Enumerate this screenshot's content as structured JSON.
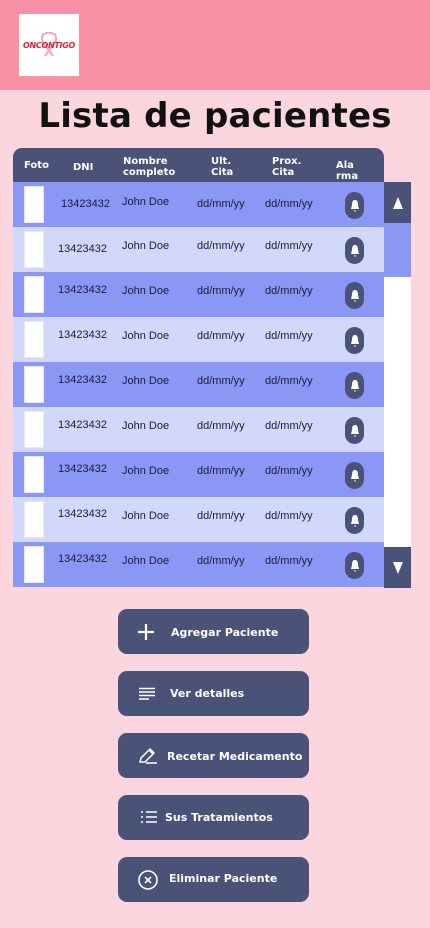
{
  "header": {
    "logo_text": "ONCONTIGO",
    "colors": {
      "bar": "#f891a5",
      "background": "#fcd6de"
    }
  },
  "page_title": "Lista de pacientes",
  "table": {
    "columns": {
      "foto": "Foto",
      "dni": "DNI",
      "nombre_1": "Nombre",
      "nombre_2": "completo",
      "ult_1": "Ult.",
      "ult_2": "Cita",
      "prox_1": "Prox.",
      "prox_2": "Cita",
      "alarma_1": "Ala",
      "alarma_2": "rma"
    },
    "rows": [
      {
        "dni": "13423432",
        "nombre": "John Doe",
        "ult_cita": "dd/mm/yy",
        "prox_cita": "dd/mm/yy"
      },
      {
        "dni": "13423432",
        "nombre": "John Doe",
        "ult_cita": "dd/mm/yy",
        "prox_cita": "dd/mm/yy"
      },
      {
        "dni": "13423432",
        "nombre": "John Doe",
        "ult_cita": "dd/mm/yy",
        "prox_cita": "dd/mm/yy"
      },
      {
        "dni": "13423432",
        "nombre": "John Doe",
        "ult_cita": "dd/mm/yy",
        "prox_cita": "dd/mm/yy"
      },
      {
        "dni": "13423432",
        "nombre": "John Doe",
        "ult_cita": "dd/mm/yy",
        "prox_cita": "dd/mm/yy"
      },
      {
        "dni": "13423432",
        "nombre": "John Doe",
        "ult_cita": "dd/mm/yy",
        "prox_cita": "dd/mm/yy"
      },
      {
        "dni": "13423432",
        "nombre": "John Doe",
        "ult_cita": "dd/mm/yy",
        "prox_cita": "dd/mm/yy"
      },
      {
        "dni": "13423432",
        "nombre": "John Doe",
        "ult_cita": "dd/mm/yy",
        "prox_cita": "dd/mm/yy"
      },
      {
        "dni": "13423432",
        "nombre": "John Doe",
        "ult_cita": "dd/mm/yy",
        "prox_cita": "dd/mm/yy"
      }
    ],
    "colors": {
      "header": "#4b5278",
      "row_dark": "#8b97f5",
      "row_light": "#d1d8fa"
    }
  },
  "scrollbar": {
    "up_icon": "triangle-up-icon",
    "down_icon": "triangle-down-icon"
  },
  "actions": [
    {
      "label": "Agregar Paciente",
      "icon": "plus-icon"
    },
    {
      "label": "Ver detalles",
      "icon": "lines-icon"
    },
    {
      "label": "Recetar Medicamento",
      "icon": "pencil-icon"
    },
    {
      "label": "Sus Tratamientos",
      "icon": "list-icon"
    },
    {
      "label": "Eliminar Paciente",
      "icon": "close-circle-icon"
    }
  ]
}
